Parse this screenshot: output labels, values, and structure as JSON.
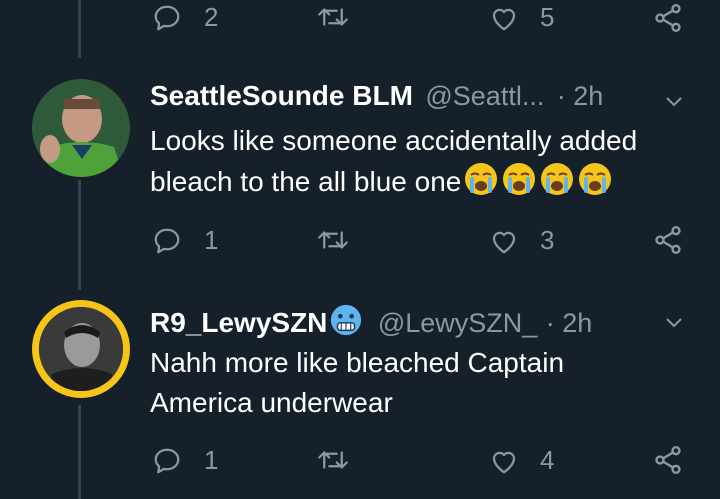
{
  "tweets": [
    {
      "actions": {
        "reply_count": "2",
        "retweet_count": "",
        "like_count": "5"
      }
    },
    {
      "author_name": "SeattleSounde BLM",
      "author_handle": "@Seattl...",
      "time": "· 2h",
      "text": "Looks like someone accidentally added bleach to the all blue one",
      "emojis": [
        "loudly-crying-face",
        "loudly-crying-face",
        "loudly-crying-face",
        "loudly-crying-face"
      ],
      "actions": {
        "reply_count": "1",
        "retweet_count": "",
        "like_count": "3"
      }
    },
    {
      "author_name": "R9_LewySZN",
      "author_handle": "@LewySZN_",
      "time": "· 2h",
      "name_emoji": "cold-face",
      "text_line1": "Nahh more like bleached Captain",
      "text_line2": "America underwear",
      "actions": {
        "reply_count": "1",
        "retweet_count": "",
        "like_count": "4"
      }
    }
  ],
  "colors": {
    "background": "#15202b",
    "muted": "#8899a6",
    "thread_line": "#38444d",
    "avatar_ring": "#f5c518"
  },
  "icons": [
    "reply-icon",
    "retweet-icon",
    "like-icon",
    "share-icon",
    "chevron-down-icon"
  ]
}
